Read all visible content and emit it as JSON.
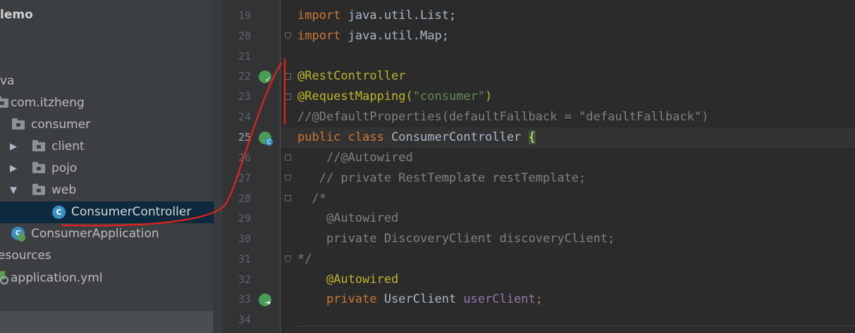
{
  "project_tree": {
    "items": [
      {
        "label": "lemo",
        "bold": true
      },
      {
        "label": "va"
      },
      {
        "label": "com.itzheng"
      },
      {
        "label": "consumer"
      },
      {
        "label": "client"
      },
      {
        "label": "pojo"
      },
      {
        "label": "web"
      },
      {
        "label": "ConsumerController",
        "selected": true
      },
      {
        "label": "ConsumerApplication"
      },
      {
        "label": "esources"
      },
      {
        "label": "application.yml"
      }
    ]
  },
  "editor": {
    "line_numbers": [
      "19",
      "20",
      "21",
      "22",
      "23",
      "24",
      "25",
      "26",
      "27",
      "28",
      "29",
      "30",
      "31",
      "32",
      "33",
      "34"
    ],
    "current_line": "25",
    "code": {
      "l19_kw": "import",
      "l19_rest": " java.util.List;",
      "l20_kw": "import",
      "l20_rest": " java.util.Map;",
      "l22": "@RestController",
      "l23_ann": "@RequestMapping(",
      "l23_str": "\"consumer\"",
      "l23_end": ")",
      "l24": "//@DefaultProperties(defaultFallback = \"defaultFallback\")",
      "l25_kw": "public class",
      "l25_name": " ConsumerController ",
      "l25_brace": "{",
      "l26": "    //@Autowired",
      "l27": "   // private RestTemplate restTemplate;",
      "l28": "  /*",
      "l29": "    @Autowired",
      "l30": "    private DiscoveryClient discoveryClient;",
      "l31": "*/",
      "l32": "    @Autowired",
      "l33_kw": "    private",
      "l33_type": " UserClient ",
      "l33_field": "userClient",
      "l33_semi": ";"
    }
  },
  "icons": {
    "c_glyph": "C",
    "collapsed": "▶",
    "expanded": "▼"
  },
  "colors": {
    "keyword": "#cc7832",
    "annotation": "#bbb529",
    "string": "#6a8759",
    "comment": "#808080",
    "field": "#9876aa",
    "ink_annotation": "#e8221b"
  }
}
